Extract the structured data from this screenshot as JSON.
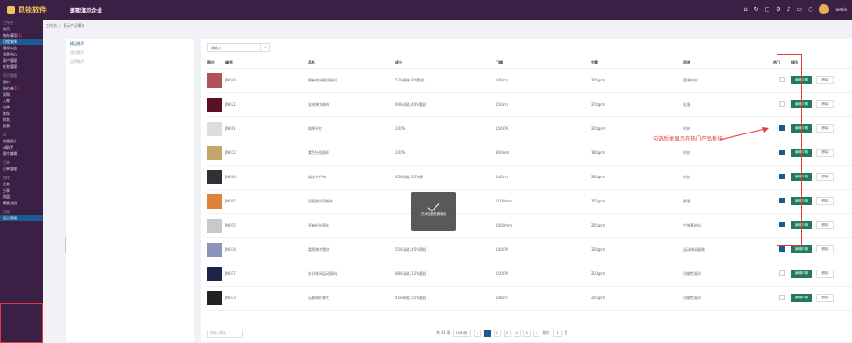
{
  "app": {
    "brand": "昆锐软件",
    "company": "即熙演示企业"
  },
  "topbar": {
    "admin_label": "admin"
  },
  "breadcrumb": {
    "home": "工作台",
    "current": "显示产品模块"
  },
  "sidebar": {
    "items": [
      {
        "label": "工作台",
        "kind": "head"
      },
      {
        "label": "首页"
      },
      {
        "label": "待办事项",
        "badge": "(1)"
      },
      {
        "label": "日程安排",
        "kind": "active"
      },
      {
        "label": "通知公告"
      },
      {
        "label": "消息中心"
      },
      {
        "label": "客户管理"
      },
      {
        "label": "任务管理"
      },
      {
        "label": "项目管理",
        "kind": "head"
      },
      {
        "label": "报价"
      },
      {
        "label": "报价单",
        "badge": "(1)"
      },
      {
        "label": "采购"
      },
      {
        "label": "入库"
      },
      {
        "label": "出库"
      },
      {
        "label": "库存"
      },
      {
        "label": "财务"
      },
      {
        "label": "报表"
      },
      {
        "label": "AI",
        "kind": "head"
      },
      {
        "label": "数据统计"
      },
      {
        "label": "AI助手"
      },
      {
        "label": "图片编辑"
      },
      {
        "label": "订单",
        "kind": "head"
      },
      {
        "label": "订单管理"
      },
      {
        "label": "协作",
        "kind": "head"
      },
      {
        "label": "任务"
      },
      {
        "label": "分享"
      },
      {
        "label": "网盘"
      },
      {
        "label": "模板文档"
      },
      {
        "label": "官网",
        "kind": "head"
      },
      {
        "label": "展示管理",
        "kind": "active"
      }
    ]
  },
  "left_nav": [
    {
      "label": "精品推荐",
      "active": true
    },
    {
      "label": "热门推荐",
      "active": false
    },
    {
      "label": "品牌推荐",
      "active": false
    }
  ],
  "search": {
    "placeholder": "请输入"
  },
  "table": {
    "headers": [
      "图片",
      "编号",
      "品名",
      "成分",
      "门幅",
      "克重",
      "用途",
      "热门",
      "操作"
    ],
    "rows": [
      {
        "code": "JN004",
        "name": "棉麻休闲格纹面料",
        "comp": "52%棉麻,8%氨纶",
        "width": "148cm",
        "weight": "165gsm",
        "use": "西装衬衫",
        "hot": false,
        "color": "#b0525b"
      },
      {
        "code": "JN021",
        "name": "丝绒弹力绒布",
        "comp": "60%涤纶,40%氨纶",
        "width": "150cm",
        "weight": "270gsm",
        "use": "礼服",
        "hot": false,
        "color": "#5a1020"
      },
      {
        "code": "JN001",
        "name": "纯棉平纹",
        "comp": "100%",
        "width": "150CM",
        "weight": "220g/m²",
        "use": "衬衫",
        "hot": true,
        "color": "#dcdcdc"
      },
      {
        "code": "JN012",
        "name": "素色针织面料",
        "comp": "100%",
        "width": "300mm",
        "weight": "180gsm",
        "use": "衬衫",
        "hot": true,
        "color": "#c6a66a"
      },
      {
        "code": "JN006",
        "name": "斜纹牛仔布",
        "comp": "65%涤纶,35%棉",
        "width": "140cm",
        "weight": "260gsm",
        "use": "衬衫",
        "hot": true,
        "color": "#303036"
      },
      {
        "code": "JN007",
        "name": "双面提花网眼布",
        "comp": "",
        "width": "1100mm",
        "weight": "155gsm",
        "use": "裤装",
        "hot": true,
        "color": "#e0823a"
      },
      {
        "code": "JN015",
        "name": "亚麻纤维面料",
        "comp": "",
        "width": "1400mm",
        "weight": "205gsm",
        "use": "生物基材料",
        "hot": true,
        "color": "#c9c9c9"
      },
      {
        "code": "JN014",
        "name": "柔滑弹力雪纺",
        "comp": "55%涤纶,45%锦纶",
        "width": "140CM",
        "weight": "320gsm",
        "use": "运动休闲服装",
        "hot": true,
        "color": "#8a94b8"
      },
      {
        "code": "JN017",
        "name": "针织休闲运动面料",
        "comp": "88%涤纶,12%氨纶",
        "width": "150CM",
        "weight": "210gsm",
        "use": "功能性面料",
        "hot": false,
        "color": "#1c2548"
      },
      {
        "code": "JN013",
        "name": "石磨锦纶弹力",
        "comp": "45%锦纶,55%氨纶",
        "width": "148cm",
        "weight": "205gsm",
        "use": "功能性面料",
        "hot": false,
        "color": "#222222"
      }
    ],
    "edit_label": "编辑详情",
    "delete_label": "删除"
  },
  "annotation": "勾选后便显示在热门产品板块",
  "toast": {
    "message": "已添加到热销商品"
  },
  "footer": {
    "filter_placeholder": "请输入筛选",
    "total": "共 41 条",
    "page_size": "10条/页",
    "pages": [
      "1",
      "2",
      "3",
      "4",
      "5"
    ],
    "current_page": "1",
    "goto_label": "前往",
    "goto_value": "1",
    "goto_suffix": "页"
  },
  "colors": {
    "sidebar_bg": "#3b1f44",
    "accent": "#1c5a92",
    "edit_btn": "#1f7b5a",
    "annotation": "#e03b3b"
  }
}
